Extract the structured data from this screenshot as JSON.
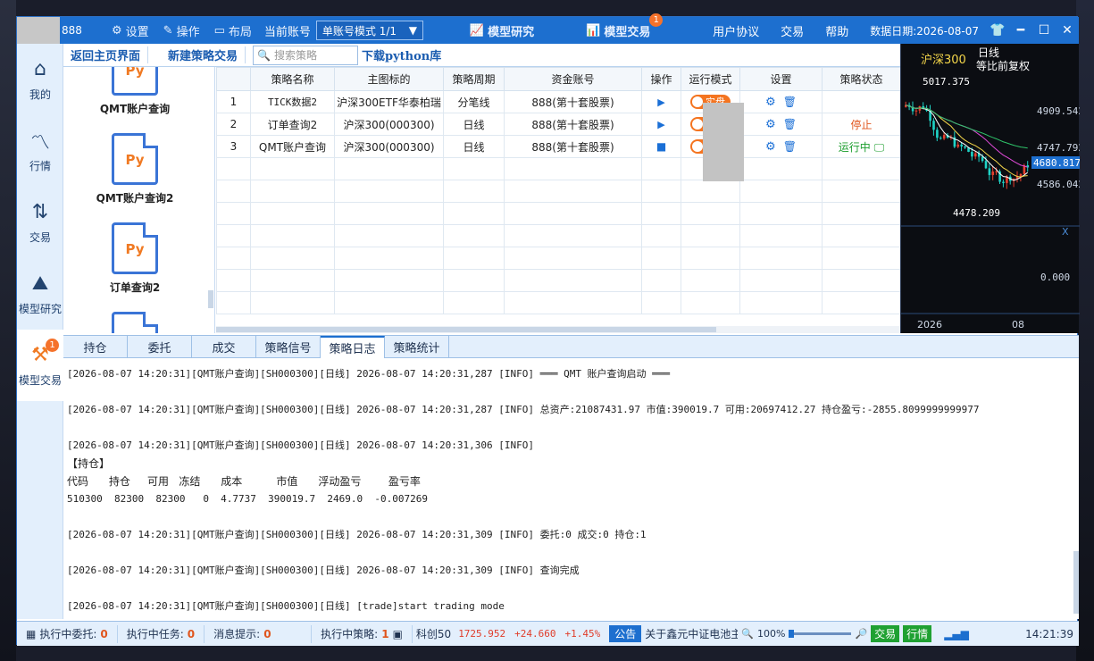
{
  "titlebar": {
    "account_suffix": "888",
    "settings": "设置",
    "operate": "操作",
    "layout": "布局",
    "current_account_label": "当前账号",
    "account_mode": "单账号模式 1/1",
    "model_research": "模型研究",
    "model_trade": "模型交易",
    "model_trade_badge": "1",
    "user_agreement": "用户协议",
    "trade": "交易",
    "help": "帮助",
    "data_date": "数据日期:2026-08-07"
  },
  "leftnav": {
    "items": [
      {
        "label": "我的",
        "icon": "home-icon"
      },
      {
        "label": "行情",
        "icon": "market-icon"
      },
      {
        "label": "交易",
        "icon": "trade-icon"
      },
      {
        "label": "模型研究",
        "icon": "research-icon"
      },
      {
        "label": "模型交易",
        "icon": "model-trade-icon",
        "badge": "1"
      }
    ]
  },
  "toolbar": {
    "back_home": "返回主页界面",
    "new_strategy": "新建策略交易",
    "search_placeholder": "搜索策略",
    "download_python": "下载python库"
  },
  "strategy_list": [
    {
      "icon_text": "Py",
      "name": "QMT账户查询"
    },
    {
      "icon_text": "Py",
      "name": "QMT账户查询2"
    },
    {
      "icon_text": "Py",
      "name": "订单查询2"
    }
  ],
  "table": {
    "headers": [
      "",
      "策略名称",
      "主图标的",
      "策略周期",
      "资金账号",
      "操作",
      "运行模式",
      "设置",
      "策略状态"
    ],
    "rows": [
      {
        "idx": "1",
        "name": "TICK数据2",
        "target": "沪深300ETF华泰柏瑞",
        "period": "分笔线",
        "account": "888(第十套股票)",
        "op": "▶",
        "mode": "实盘",
        "status": ""
      },
      {
        "idx": "2",
        "name": "订单查询2",
        "target": "沪深300(000300)",
        "period": "日线",
        "account": "888(第十套股票)",
        "op": "▶",
        "mode": "实盘",
        "status": "停止"
      },
      {
        "idx": "3",
        "name": "QMT账户查询",
        "target": "沪深300(000300)",
        "period": "日线",
        "account": "888(第十套股票)",
        "op": "■",
        "mode": "实盘",
        "status": "运行中"
      }
    ]
  },
  "chart": {
    "title": "沪深300",
    "period": "日线",
    "adjust": "等比前复权",
    "high_label": "5017.375",
    "low_label": "4478.209",
    "ticks": [
      "4909.542",
      "4747.792",
      "4586.042"
    ],
    "current_price": "4680.817",
    "sub_zero": "0.000",
    "x_labels": [
      "2026",
      "08"
    ],
    "close_x": "X",
    "colors": {
      "up": "#e8402f",
      "down": "#1fd3c6",
      "ma1": "#ffffff",
      "ma2": "#f5d74a",
      "ma3": "#e04ad8",
      "ma4": "#2fc46a"
    }
  },
  "chart_data": {
    "type": "candlestick",
    "title": "沪深300",
    "ylim": [
      4478.209,
      5017.375
    ],
    "high": 5017.375,
    "low": 4478.209,
    "last": 4680.817
  },
  "tabs": [
    "持仓",
    "委托",
    "成交",
    "策略信号",
    "策略日志",
    "策略统计"
  ],
  "active_tab": 4,
  "log": {
    "lines": [
      "[2026-08-07 14:20:31][QMT账户查询][SH000300][日线] 2026-08-07 14:20:31,287 [INFO] ═══ QMT 账户查询启动 ═══",
      "",
      "[2026-08-07 14:20:31][QMT账户查询][SH000300][日线] 2026-08-07 14:20:31,287 [INFO] 总资产:21087431.97 市值:390019.7 可用:20697412.27 持仓盈亏:-2855.8099999999977",
      "",
      "[2026-08-07 14:20:31][QMT账户查询][SH000300][日线] 2026-08-07 14:20:31,306 [INFO]",
      "【持仓】",
      "代码      持仓     可用   冻结      成本          市值      浮动盈亏        盈亏率",
      "510300  82300  82300   0  4.7737  390019.7  2469.0  -0.007269",
      "",
      "[2026-08-07 14:20:31][QMT账户查询][SH000300][日线] 2026-08-07 14:20:31,309 [INFO] 委托:0 成交:0 持仓:1",
      "",
      "[2026-08-07 14:20:31][QMT账户查询][SH000300][日线] 2026-08-07 14:20:31,309 [INFO] 查询完成",
      "",
      "[2026-08-07 14:20:31][QMT账户查询][SH000300][日线] [trade]start trading mode"
    ]
  },
  "status": {
    "exec_orders_label": "执行中委托:",
    "exec_orders": "0",
    "exec_tasks_label": "执行中任务:",
    "exec_tasks": "0",
    "msg_label": "消息提示:",
    "msg": "0",
    "exec_strat_label": "执行中策略:",
    "exec_strat": "1",
    "index_name": "科创50",
    "index_price": "1725.952",
    "index_change": "+24.660",
    "index_pct": "+1.45%",
    "notice_label": "公告",
    "notice_text": "关于鑫元中证电池主",
    "zoom": "100%",
    "btn_trade": "交易",
    "btn_market": "行情",
    "clock": "14:21:39"
  }
}
